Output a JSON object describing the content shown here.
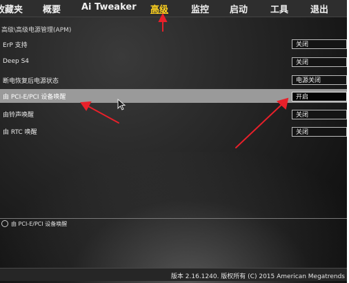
{
  "menu": {
    "items": [
      {
        "label": "收藏夹"
      },
      {
        "label": "概要"
      },
      {
        "label": "Ai Tweaker"
      },
      {
        "label": "高级"
      },
      {
        "label": "监控"
      },
      {
        "label": "启动"
      },
      {
        "label": "工具"
      },
      {
        "label": "退出"
      }
    ]
  },
  "breadcrumb": "高级\\高级电源管理(APM)",
  "settings": [
    {
      "label": "ErP 支持",
      "value": "关闭"
    },
    {
      "label": "Deep S4",
      "value": "关闭"
    },
    {
      "label": "断电恢复后电源状态",
      "value": "电源关闭"
    },
    {
      "label": "由 PCI-E/PCI 设备唤醒",
      "value": "开启"
    },
    {
      "label": "由铃声唤醒",
      "value": "关闭"
    },
    {
      "label": "由 RTC 唤醒",
      "value": "关闭"
    }
  ],
  "help": {
    "text": "由 PCI-E/PCI 设备唤醒"
  },
  "footer": {
    "version": "版本 2.16.1240. 版权所有 (C) 2015 American Megatrends"
  },
  "colors": {
    "active_tab": "#ffd21e",
    "annotation_arrow": "#e8202a",
    "selected_row": "#9a9a9a"
  }
}
